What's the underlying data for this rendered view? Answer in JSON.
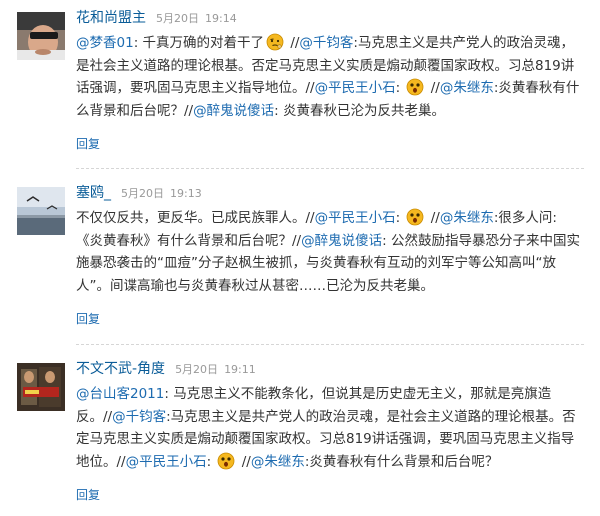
{
  "comments": [
    {
      "author": "花和尚盟主",
      "date": "5月20日",
      "time": "19:14",
      "reply_label": "回复",
      "segments": [
        {
          "type": "mention",
          "text": "@梦香01"
        },
        {
          "type": "text",
          "text": ": 千真万确的对着干了"
        },
        {
          "type": "emoji",
          "name": "thinking-emoji"
        },
        {
          "type": "text",
          "text": " //"
        },
        {
          "type": "mention",
          "text": "@千钧客"
        },
        {
          "type": "text",
          "text": ":马克思主义是共产党人的政治灵魂，是社会主义道路的理论根基。否定马克思主义实质是煽动颠覆国家政权。习总819讲话强调，要巩固马克思主义指导地位。//"
        },
        {
          "type": "mention",
          "text": "@平民王小石"
        },
        {
          "type": "text",
          "text": ": "
        },
        {
          "type": "emoji",
          "name": "shocked-emoji"
        },
        {
          "type": "text",
          "text": " //"
        },
        {
          "type": "mention",
          "text": "@朱继东"
        },
        {
          "type": "text",
          "text": ":炎黄春秋有什么背景和后台呢？//"
        },
        {
          "type": "mention",
          "text": "@醉鬼说傻话"
        },
        {
          "type": "text",
          "text": ": 炎黄春秋已沦为反共老巢。"
        }
      ]
    },
    {
      "author": "塞鸥_",
      "date": "5月20日",
      "time": "19:13",
      "reply_label": "回复",
      "segments": [
        {
          "type": "text",
          "text": "不仅仅反共，更反华。已成民族罪人。//"
        },
        {
          "type": "mention",
          "text": "@平民王小石"
        },
        {
          "type": "text",
          "text": ": "
        },
        {
          "type": "emoji",
          "name": "shocked-emoji"
        },
        {
          "type": "text",
          "text": " //"
        },
        {
          "type": "mention",
          "text": "@朱继东"
        },
        {
          "type": "text",
          "text": ":很多人问: 《炎黄春秋》有什么背景和后台呢？//"
        },
        {
          "type": "mention",
          "text": "@醉鬼说傻话"
        },
        {
          "type": "text",
          "text": ": 公然鼓励指导暴恐分子来中国实施暴恐袭击的“皿痘”分子赵枫生被抓，与炎黄春秋有互动的刘军宁等公知高叫“放人”。间谍高瑜也与炎黄春秋过从甚密……已沦为反共老巢。"
        }
      ]
    },
    {
      "author": "不文不武-角度",
      "date": "5月20日",
      "time": "19:11",
      "reply_label": "回复",
      "segments": [
        {
          "type": "mention",
          "text": "@台山客2011"
        },
        {
          "type": "text",
          "text": ": 马克思主义不能教条化，但说其是历史虚无主义，那就是亮旗造反。//"
        },
        {
          "type": "mention",
          "text": "@千钧客"
        },
        {
          "type": "text",
          "text": ":马克思主义是共产党人的政治灵魂，是社会主义道路的理论根基。否定马克思主义实质是煽动颠覆国家政权。习总819讲话强调，要巩固马克思主义指导地位。//"
        },
        {
          "type": "mention",
          "text": "@平民王小石"
        },
        {
          "type": "text",
          "text": ": "
        },
        {
          "type": "emoji",
          "name": "shocked-emoji"
        },
        {
          "type": "text",
          "text": " //"
        },
        {
          "type": "mention",
          "text": "@朱继东"
        },
        {
          "type": "text",
          "text": ":炎黄春秋有什么背景和后台呢？"
        }
      ]
    }
  ],
  "colors": {
    "link": "#1d6bb0",
    "author": "#0a5c98",
    "meta": "#999999",
    "text": "#333333",
    "emoji": "#f5b820"
  }
}
